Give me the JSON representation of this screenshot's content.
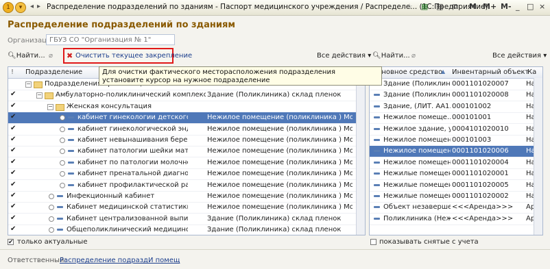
{
  "window": {
    "title": "Распределение подразделений по зданиям - Паспорт медицинского учреждения / Распределе... (1С:Предприятие)",
    "buttons": [
      "M",
      "M+",
      "M-",
      "_",
      "□",
      "×"
    ]
  },
  "form": {
    "heading": "Распределение подразделений по зданиям",
    "org_label": "Организация:",
    "org_value": "ГБУЗ СО \"Организация № 1\""
  },
  "left_toolbar": {
    "find": "Найти...",
    "clear": "Очистить текущее закрепление",
    "all_actions": "Все действия"
  },
  "right_toolbar": {
    "find": "Найти...",
    "all_actions": "Все действия"
  },
  "tooltip": "Для очистки фактического месторасположения подразделения установите курсор на нужное подразделение",
  "left_table": {
    "header": "Подразделение",
    "rows": [
      {
        "name": "Подразделения организации",
        "building": "",
        "check": ""
      },
      {
        "name": "Амбулаторно-поликлинический комплекс №1",
        "building": "Здание  (Поликлиника) склад пленок",
        "check": "✔"
      },
      {
        "name": "Женская консультация",
        "building": "",
        "check": "✔"
      },
      {
        "name": "кабинет гинекологии детского и подр...",
        "building": "Нежилое   помещение   (поликлиника )   Моск...",
        "check": "✔"
      },
      {
        "name": "кабинет гинекологической эндокрино...",
        "building": "Нежилое   помещение   (поликлиника )   Моск...",
        "check": "✔"
      },
      {
        "name": "кабинет невынашивания беременности",
        "building": "Нежилое   помещение   (поликлиника )   Моск...",
        "check": "✔"
      },
      {
        "name": "кабинет патологии шейки матки",
        "building": "Нежилое   помещение   (поликлиника )   Моск...",
        "check": "✔"
      },
      {
        "name": "кабинет по патологии молочной железы",
        "building": "Нежилое   помещение   (поликлиника )   Моск...",
        "check": "✔"
      },
      {
        "name": "кабинет пренатальной диагностики",
        "building": "Нежилое   помещение   (поликлиника )   Моск...",
        "check": "✔"
      },
      {
        "name": "кабинет профилактической работы",
        "building": "Нежилое   помещение   (поликлиника )   Моск...",
        "check": "✔"
      },
      {
        "name": "Инфекционный кабинет",
        "building": "Нежилое   помещение   (поликлиника )   Моск...",
        "check": "✔"
      },
      {
        "name": "Кабинет медицинской статистики",
        "building": "Нежилое   помещение   (поликлиника )   Моск...",
        "check": "✔"
      },
      {
        "name": "Кабинет централизованной выписки реце...",
        "building": "Здание  (Поликлиника) склад пленок",
        "check": "✔"
      },
      {
        "name": "Общеполиклинический медицинский перс...",
        "building": "Здание  (Поликлиника) склад пленок",
        "check": "✔"
      }
    ]
  },
  "right_table": {
    "headers": [
      "Основное средство",
      "Инвентарный объект",
      "Ка"
    ],
    "rows": [
      {
        "asset": "Здание  (Поликлин...",
        "inv": "0001101020007",
        "k": "На"
      },
      {
        "asset": "Здание  (Поликлин...",
        "inv": "0001101020008",
        "k": "На"
      },
      {
        "asset": "Здание, (ЛИТ. АА1...",
        "inv": "000101002",
        "k": "На"
      },
      {
        "asset": "Нежилое    помеще...",
        "inv": "000101001",
        "k": "На"
      },
      {
        "asset": "Нежилое здание, у...",
        "inv": "0004101020010",
        "k": "На"
      },
      {
        "asset": "Нежилое помещен...",
        "inv": "000101003",
        "k": "На"
      },
      {
        "asset": "Нежилое помещен...",
        "inv": "0001101020006",
        "k": "На"
      },
      {
        "asset": "Нежилое помещен...",
        "inv": "0001101020004",
        "k": "На"
      },
      {
        "asset": "Нежилые помещен...",
        "inv": "0001101020001",
        "k": "На"
      },
      {
        "asset": "Нежилые помещен...",
        "inv": "0001101020005",
        "k": "На"
      },
      {
        "asset": "Нежилые помещен...",
        "inv": "0001101020002",
        "k": "На"
      },
      {
        "asset": "Объект незаверше...",
        "inv": "<<<Аренда>>>",
        "k": "Ар"
      },
      {
        "asset": "Поликлиника (Неж...",
        "inv": "<<<Аренда>>>",
        "k": "Ар"
      }
    ]
  },
  "footer": {
    "only_actual": "только актуальные",
    "show_removed": "показывать снятые с учета",
    "responsible_label": "Ответственный:",
    "responsible_link": "Распределение подразд",
    "responsible_link2": "И помещ"
  }
}
